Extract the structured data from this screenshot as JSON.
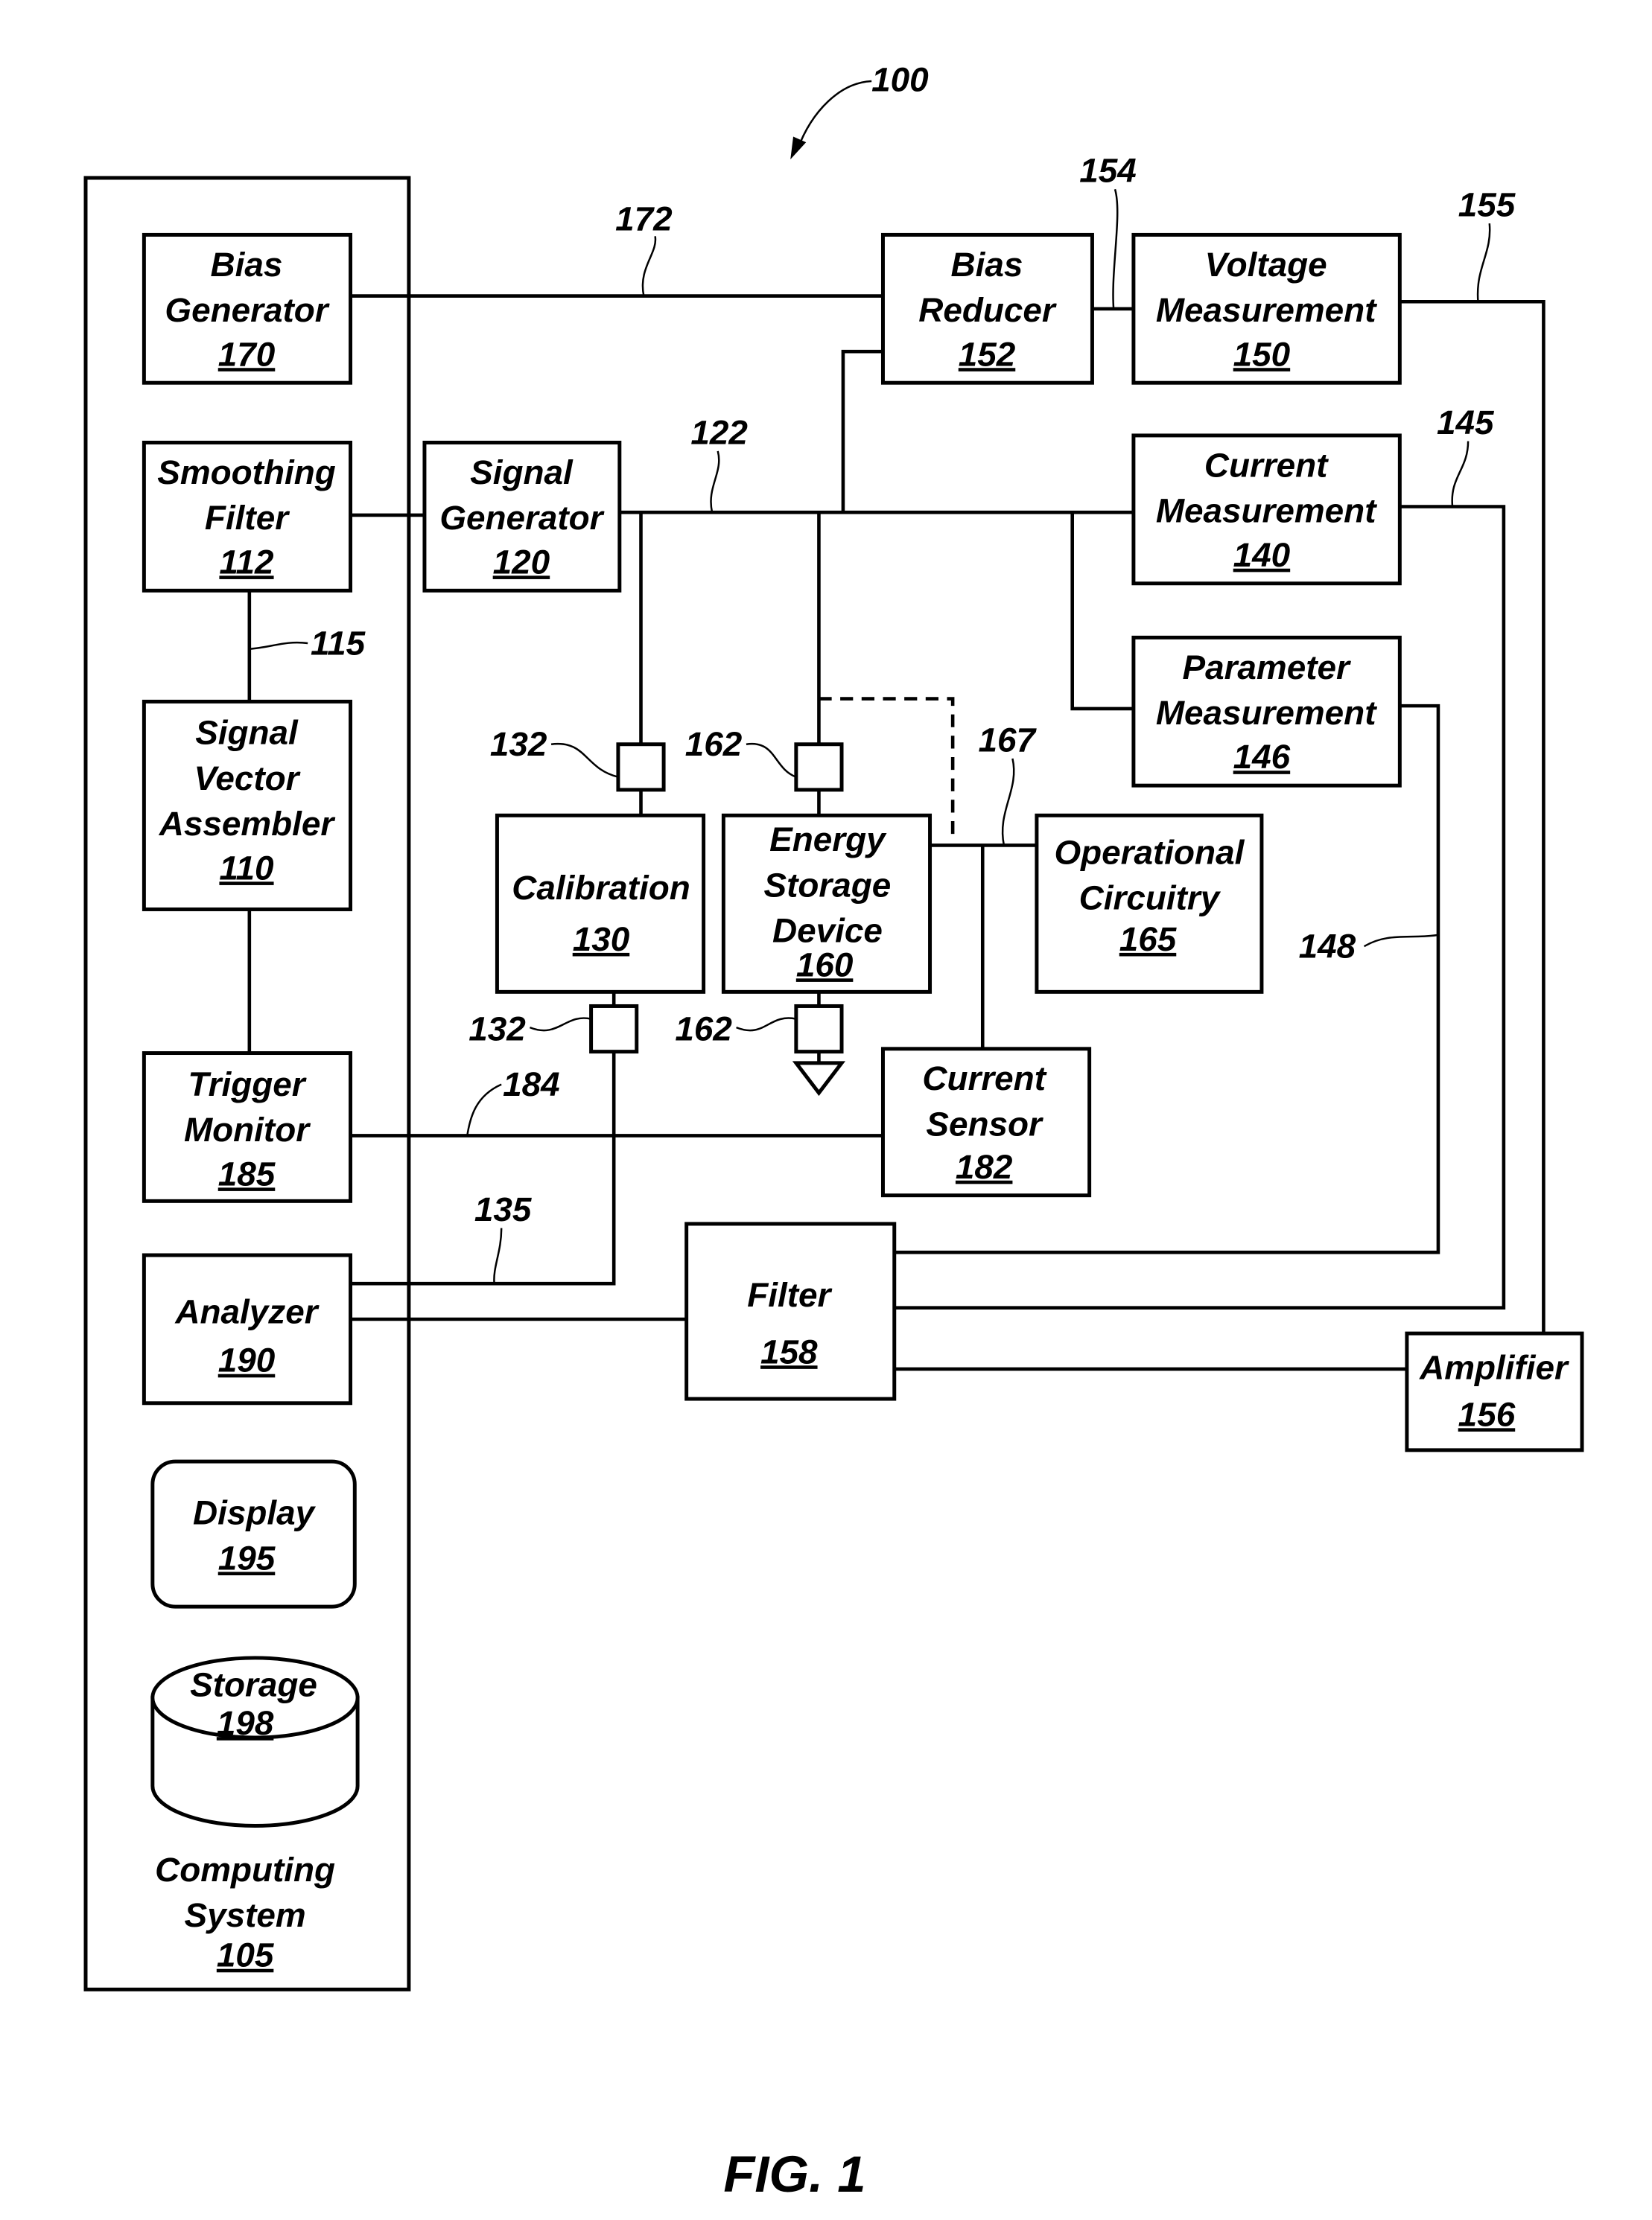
{
  "figure": {
    "title": "FIG. 1",
    "system_ref": "100"
  },
  "blocks": {
    "computing_system": {
      "lines": [
        "Computing",
        "System"
      ],
      "num": "105"
    },
    "bias_generator": {
      "lines": [
        "Bias",
        "Generator"
      ],
      "num": "170"
    },
    "smoothing_filter": {
      "lines": [
        "Smoothing",
        "Filter"
      ],
      "num": "112"
    },
    "signal_vector_assembler": {
      "lines": [
        "Signal",
        "Vector",
        "Assembler"
      ],
      "num": "110"
    },
    "trigger_monitor": {
      "lines": [
        "Trigger",
        "Monitor"
      ],
      "num": "185"
    },
    "analyzer": {
      "lines": [
        "Analyzer"
      ],
      "num": "190"
    },
    "display": {
      "lines": [
        "Display"
      ],
      "num": "195"
    },
    "storage": {
      "lines": [
        "Storage"
      ],
      "num": "198"
    },
    "signal_generator": {
      "lines": [
        "Signal",
        "Generator"
      ],
      "num": "120"
    },
    "bias_reducer": {
      "lines": [
        "Bias",
        "Reducer"
      ],
      "num": "152"
    },
    "voltage_measurement": {
      "lines": [
        "Voltage",
        "Measurement"
      ],
      "num": "150"
    },
    "current_measurement": {
      "lines": [
        "Current",
        "Measurement"
      ],
      "num": "140"
    },
    "parameter_measurement": {
      "lines": [
        "Parameter",
        "Measurement"
      ],
      "num": "146"
    },
    "calibration": {
      "lines": [
        "Calibration"
      ],
      "num": "130"
    },
    "energy_storage_device": {
      "lines": [
        "Energy",
        "Storage",
        "Device"
      ],
      "num": "160"
    },
    "operational_circuitry": {
      "lines": [
        "Operational",
        "Circuitry"
      ],
      "num": "165"
    },
    "current_sensor": {
      "lines": [
        "Current",
        "Sensor"
      ],
      "num": "182"
    },
    "filter": {
      "lines": [
        "Filter"
      ],
      "num": "158"
    },
    "amplifier": {
      "lines": [
        "Amplifier"
      ],
      "num": "156"
    }
  },
  "references": {
    "r172": "172",
    "r154": "154",
    "r155": "155",
    "r122": "122",
    "r145": "145",
    "r115": "115",
    "r132a": "132",
    "r132b": "132",
    "r162a": "162",
    "r162b": "162",
    "r167": "167",
    "r148": "148",
    "r184": "184",
    "r135": "135"
  }
}
